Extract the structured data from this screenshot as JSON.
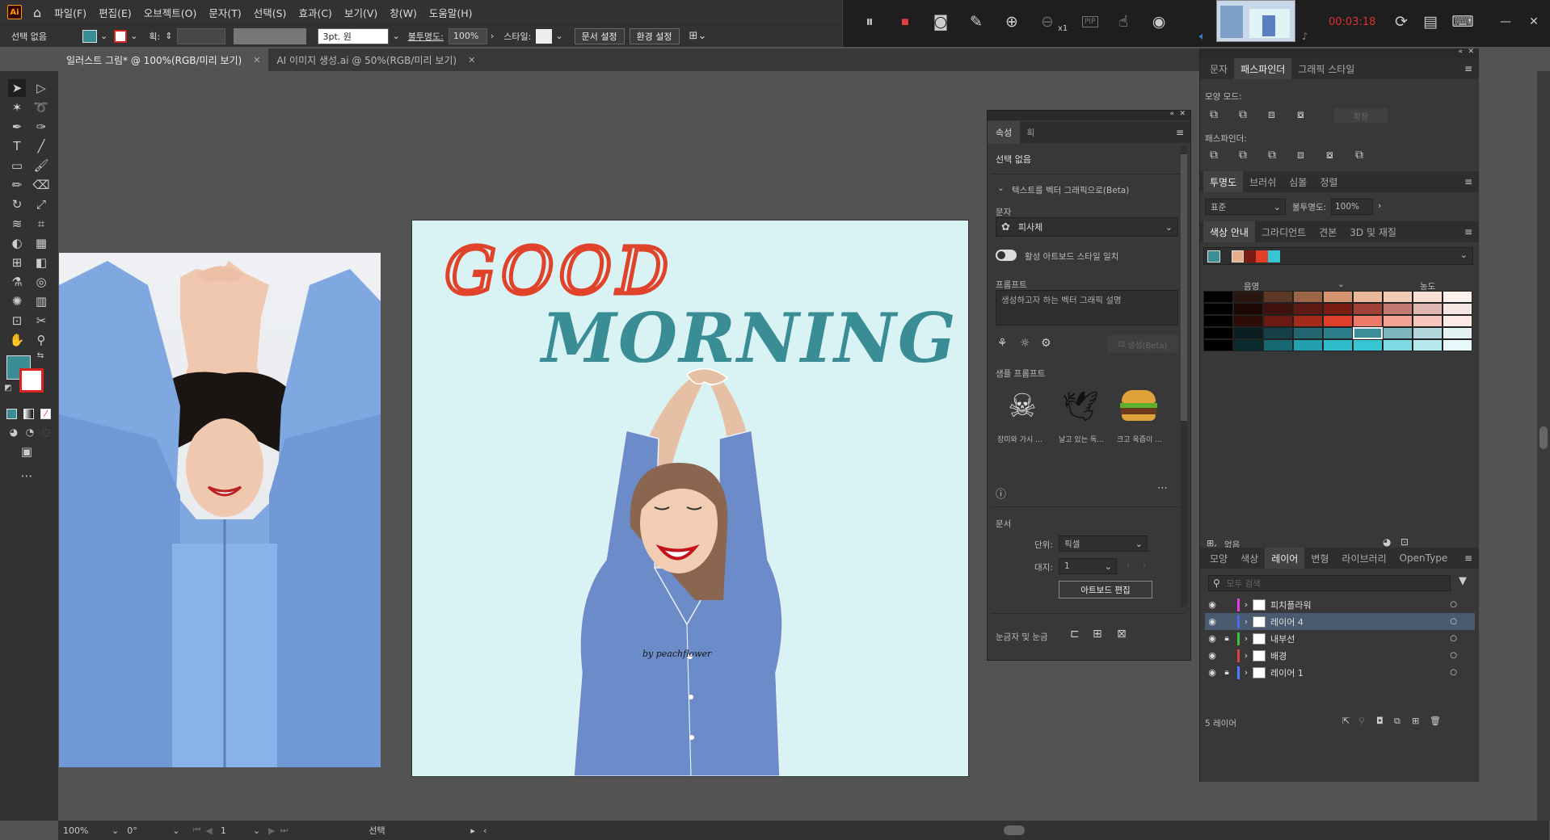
{
  "menubar": {
    "logo": "Ai",
    "items": [
      "파일(F)",
      "편집(E)",
      "오브젝트(O)",
      "문자(T)",
      "선택(S)",
      "효과(C)",
      "보기(V)",
      "창(W)",
      "도움말(H)"
    ]
  },
  "recorder": {
    "zoom_label": "x1",
    "pip_label": "PIP",
    "timer": "00:03:18"
  },
  "controlbar": {
    "selection": "선택 없음",
    "stroke_label": "획:",
    "brush_size": "3pt. 원",
    "opacity_label": "불투명도:",
    "opacity_value": "100%",
    "style_label": "스타일:",
    "doc_setup": "문서 설정",
    "preferences": "환경 설정"
  },
  "tabs": [
    {
      "label": "일러스트 그림* @ 100%(RGB/미리 보기)",
      "active": true
    },
    {
      "label": "AI 이미지 생성.ai @ 50%(RGB/미리 보기)",
      "active": false
    }
  ],
  "artwork": {
    "good": "GOOD",
    "morning": "MORNING",
    "signature": "by peachflower",
    "good_color": "#e0422a",
    "morning_color": "#3a8d95"
  },
  "properties": {
    "tabs": [
      "속성",
      "획"
    ],
    "no_selection": "선택 없음",
    "text_to_vector": "텍스트를 벡터 그래픽으로(Beta)",
    "subject_label": "문자",
    "subject_value": "피사체",
    "match_style": "활성 아트보드 스타일 일치",
    "prompt_label": "프롬프트",
    "prompt_placeholder": "생성하고자 하는 벡터 그래픽 설명",
    "generate_button": "생성(Beta)",
    "sample_label": "샘플 프롬프트",
    "samples": [
      "장미와 가시 ...",
      "날고 있는 독...",
      "크고 육즙이 ..."
    ],
    "document_label": "문서",
    "units_label": "단위:",
    "units_value": "픽셀",
    "artboard_label": "대지:",
    "artboard_value": "1",
    "edit_artboards": "아트보드 편집",
    "rulers_label": "눈금자 및 눈금"
  },
  "pathfinder": {
    "tabs": [
      "문자",
      "패스파인더",
      "그래픽 스타일"
    ],
    "shape_modes": "모양 모드:",
    "expand": "확장",
    "pathfinders": "패스파인더:"
  },
  "transparency": {
    "tabs": [
      "투명도",
      "브러쉬",
      "심볼",
      "정렬"
    ],
    "blend_mode": "표준",
    "opacity_label": "불투명도:",
    "opacity_value": "100%"
  },
  "color_guide": {
    "tabs": [
      "색상 안내",
      "그라디언트",
      "견본",
      "3D 및 재질"
    ],
    "shade_label": "음영",
    "tint_label": "농도",
    "harmony": [
      "#3b8d96",
      "#e7b08d",
      "#7a1c14",
      "#e0402a",
      "#36c6d3"
    ],
    "grid": [
      [
        "#000000",
        "#2a1810",
        "#5d3826",
        "#9c6547",
        "#d49570",
        "#e9b89a",
        "#f1cbb5",
        "#f8e1d4",
        "#fdf2ec"
      ],
      [
        "#000000",
        "#1e0806",
        "#3e110c",
        "#5f1a13",
        "#7a1c14",
        "#a04036",
        "#c37a72",
        "#e0b7b2",
        "#f5e6e4"
      ],
      [
        "#000000",
        "#2e0c07",
        "#6a1a10",
        "#a42a1a",
        "#e0402a",
        "#ed7a68",
        "#f3a194",
        "#f8c6be",
        "#fde9e6"
      ],
      [
        "#000000",
        "#0a1d20",
        "#164047",
        "#236670",
        "#2c7f8a",
        "#3b8d96",
        "#7ab6bc",
        "#b3d7da",
        "#e2f1f2"
      ],
      [
        "#000000",
        "#0b2a2e",
        "#176872",
        "#22a0ae",
        "#2fbccb",
        "#36c6d3",
        "#7fdbe3",
        "#b4eaee",
        "#e6f8f9"
      ]
    ],
    "none_label": "없음"
  },
  "layers": {
    "tabs": [
      "모양",
      "색상",
      "레이어",
      "변형",
      "라이브러리",
      "OpenType"
    ],
    "search_placeholder": "모두 검색",
    "rows": [
      {
        "name": "피치플라워",
        "color": "#e040e0",
        "locked": false,
        "selected": false
      },
      {
        "name": "레이어 4",
        "color": "#4a6ce0",
        "locked": false,
        "selected": true
      },
      {
        "name": "내부선",
        "color": "#40c040",
        "locked": true,
        "selected": false
      },
      {
        "name": "배경",
        "color": "#e04040",
        "locked": false,
        "selected": false
      },
      {
        "name": "레이어 1",
        "color": "#4a80ff",
        "locked": true,
        "selected": false
      }
    ],
    "count": "5 레이어"
  },
  "statusbar": {
    "zoom": "100%",
    "rotation": "0°",
    "artboard": "1",
    "tool": "선택"
  }
}
